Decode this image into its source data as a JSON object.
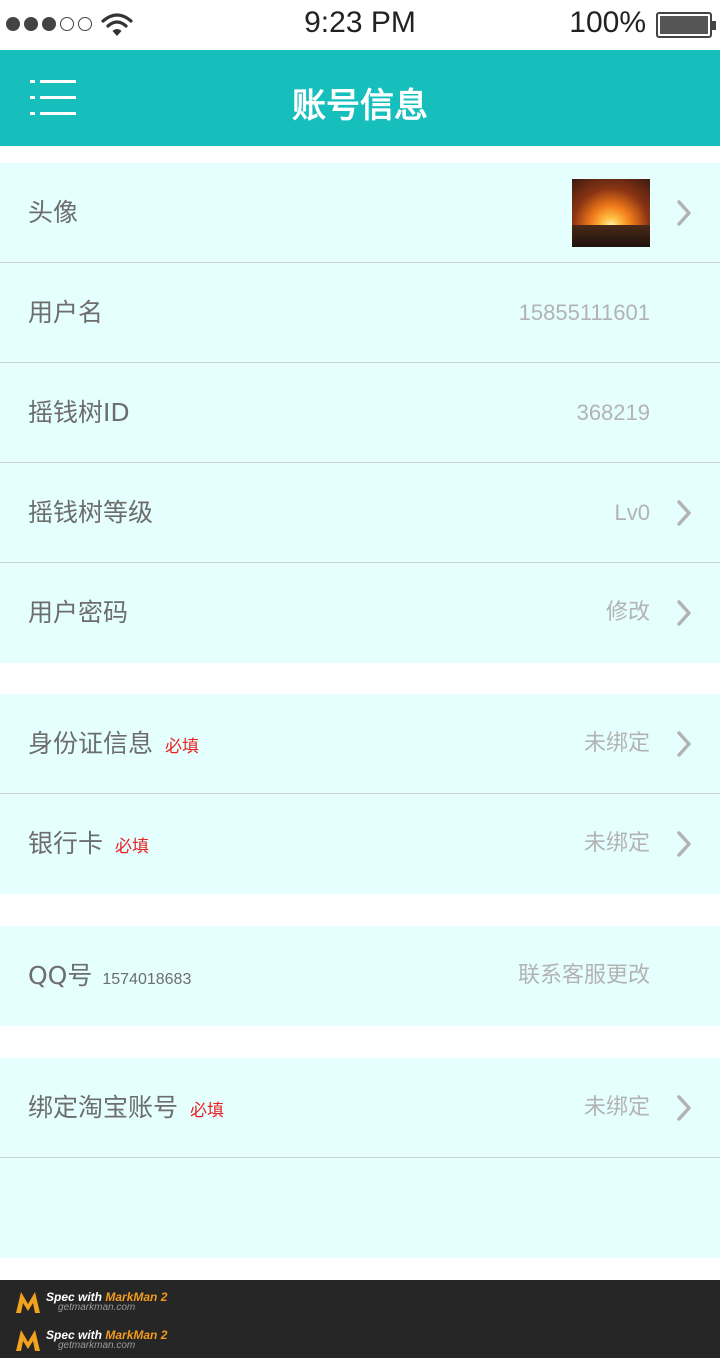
{
  "status_bar": {
    "time": "9:23 PM",
    "battery": "100%",
    "signal_dots_filled": 3,
    "signal_dots_total": 5
  },
  "header": {
    "title": "账号信息",
    "menu_icon": "menu-icon"
  },
  "colors": {
    "header_bg": "#16bebc",
    "row_bg": "#e5fffe",
    "label": "#6d6d6d",
    "value": "#b3b3b3",
    "required": "#ea2222"
  },
  "section1": {
    "avatar": {
      "label": "头像"
    },
    "username": {
      "label": "用户名",
      "value": "15855111601"
    },
    "tree_id": {
      "label": "摇钱树ID",
      "value": "368219"
    },
    "tree_level": {
      "label": "摇钱树等级",
      "value": "Lv0"
    },
    "password": {
      "label": "用户密码",
      "value": "修改"
    }
  },
  "section2": {
    "id_info": {
      "label": "身份证信息",
      "required": "必填",
      "value": "未绑定"
    },
    "bank_card": {
      "label": "银行卡",
      "required": "必填",
      "value": "未绑定"
    }
  },
  "section3": {
    "qq": {
      "label": "QQ号",
      "number": "1574018683",
      "value": "联系客服更改"
    }
  },
  "section4": {
    "taobao": {
      "label": "绑定淘宝账号",
      "required": "必填",
      "value": "未绑定"
    }
  },
  "footer": {
    "spec_prefix": "Spec with",
    "brand": "MarkMan 2",
    "site": "getmarkman.com"
  }
}
